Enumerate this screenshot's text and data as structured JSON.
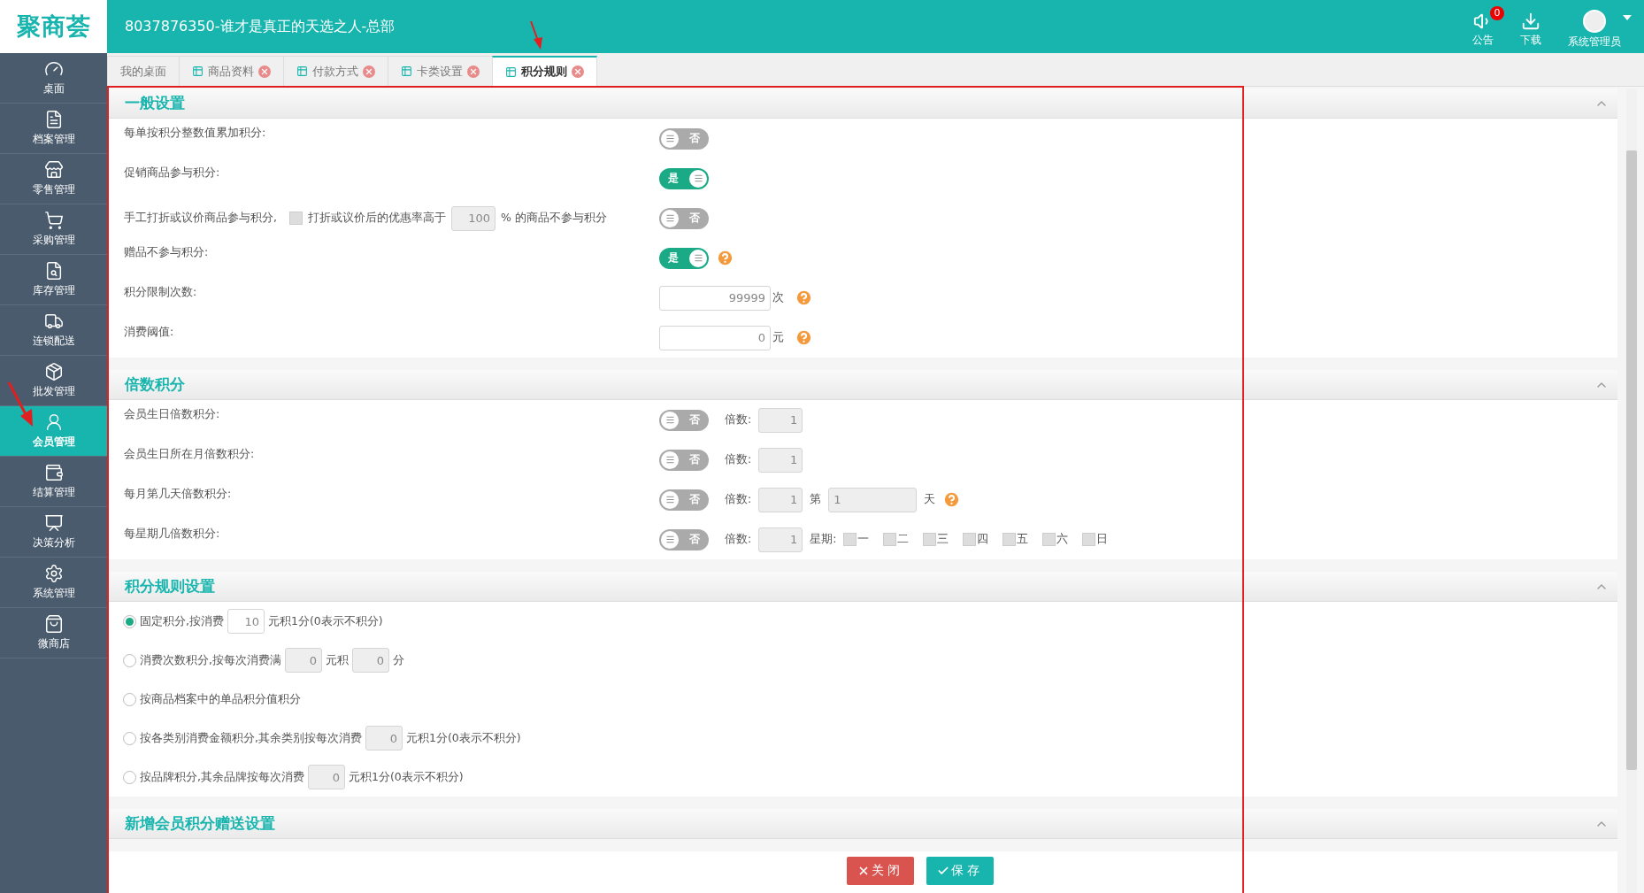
{
  "header": {
    "logo": "聚商荟",
    "title": "8037876350-谁才是真正的天选之人-总部",
    "actions": [
      {
        "kind": "notice",
        "label": "公告",
        "badge": "0"
      },
      {
        "kind": "download",
        "label": "下载"
      },
      {
        "kind": "user",
        "label": "系统管理员"
      }
    ]
  },
  "sidebar": {
    "items": [
      {
        "label": "桌面",
        "selected": false
      },
      {
        "label": "档案管理",
        "selected": false
      },
      {
        "label": "零售管理",
        "selected": false
      },
      {
        "label": "采购管理",
        "selected": false
      },
      {
        "label": "库存管理",
        "selected": false
      },
      {
        "label": "连锁配送",
        "selected": false
      },
      {
        "label": "批发管理",
        "selected": false
      },
      {
        "label": "会员管理",
        "selected": true
      },
      {
        "label": "结算管理",
        "selected": false
      },
      {
        "label": "决策分析",
        "selected": false
      },
      {
        "label": "系统管理",
        "selected": false
      },
      {
        "label": "微商店",
        "selected": false
      }
    ]
  },
  "tabs": [
    {
      "label": "我的桌面",
      "closable": false,
      "selected": false
    },
    {
      "label": "商品资料",
      "closable": true,
      "selected": false
    },
    {
      "label": "付款方式",
      "closable": true,
      "selected": false
    },
    {
      "label": "卡类设置",
      "closable": true,
      "selected": false
    },
    {
      "label": "积分规则",
      "closable": true,
      "selected": true
    }
  ],
  "sections": [
    {
      "title": "一般设置",
      "expanded": true,
      "rows": [
        {
          "kind": "toggle",
          "label": "每单按积分整数值累加积分:",
          "on": false,
          "toggle_text": "否"
        },
        {
          "kind": "toggle",
          "label": "促销商品参与积分:",
          "on": true,
          "toggle_text": "是"
        },
        {
          "kind": "discount",
          "label": "手工打折或议价商品参与积分,",
          "checked": false,
          "text": "打折或议价后的优惠率高于",
          "value": "100",
          "suffix": "% 的商品不参与积分",
          "on": false,
          "toggle_text": "否"
        },
        {
          "kind": "toggle",
          "label": "赠品不参与积分:",
          "on": true,
          "toggle_text": "是",
          "help": true
        },
        {
          "kind": "number",
          "label": "积分限制次数:",
          "value": "99999",
          "unit": "次",
          "help": true
        },
        {
          "kind": "number",
          "label": "消费阈值:",
          "value": "0",
          "unit": "元",
          "help": true
        }
      ]
    },
    {
      "title": "倍数积分",
      "expanded": true,
      "rows": [
        {
          "kind": "multiplier",
          "label": "会员生日倍数积分:",
          "on": false,
          "toggle_text": "否",
          "multiplier_label": "倍数:",
          "multiplier": "1"
        },
        {
          "kind": "multiplier",
          "label": "会员生日所在月倍数积分:",
          "on": false,
          "toggle_text": "否",
          "multiplier_label": "倍数:",
          "multiplier": "1"
        },
        {
          "kind": "multiplier",
          "label": "每月第几天倍数积分:",
          "on": false,
          "toggle_text": "否",
          "multiplier_label": "倍数:",
          "multiplier": "1",
          "day_prefix": "第",
          "day_value": "1",
          "day_suffix": "天",
          "help": true
        },
        {
          "kind": "multiplier",
          "label": "每星期几倍数积分:",
          "on": false,
          "toggle_text": "否",
          "multiplier_label": "倍数:",
          "multiplier": "1",
          "weekday_label": "星期:",
          "weekdays": [
            {
              "label": "一",
              "checked": false
            },
            {
              "label": "二",
              "checked": false
            },
            {
              "label": "三",
              "checked": false
            },
            {
              "label": "四",
              "checked": false
            },
            {
              "label": "五",
              "checked": false
            },
            {
              "label": "六",
              "checked": false
            },
            {
              "label": "日",
              "checked": false
            }
          ]
        }
      ]
    },
    {
      "title": "积分规则设置",
      "expanded": true,
      "rows": [
        {
          "kind": "radio",
          "selected": true,
          "parts": [
            {
              "kind": "text",
              "text": "固定积分,按消费"
            },
            {
              "kind": "input",
              "value": "10"
            },
            {
              "kind": "text",
              "text": "元积1分(0表示不积分)"
            }
          ]
        },
        {
          "kind": "radio",
          "selected": false,
          "parts": [
            {
              "kind": "text",
              "text": "消费次数积分,按每次消费满"
            },
            {
              "kind": "input",
              "value": "0"
            },
            {
              "kind": "text",
              "text": "元积"
            },
            {
              "kind": "input",
              "value": "0"
            },
            {
              "kind": "text",
              "text": "分"
            }
          ]
        },
        {
          "kind": "radio",
          "selected": false,
          "parts": [
            {
              "kind": "text",
              "text": "按商品档案中的单品积分值积分"
            }
          ]
        },
        {
          "kind": "radio",
          "selected": false,
          "parts": [
            {
              "kind": "text",
              "text": "按各类别消费金额积分,其余类别按每次消费"
            },
            {
              "kind": "input",
              "value": "0"
            },
            {
              "kind": "text",
              "text": "元积1分(0表示不积分)"
            }
          ]
        },
        {
          "kind": "radio",
          "selected": false,
          "parts": [
            {
              "kind": "text",
              "text": "按品牌积分,其余品牌按每次消费"
            },
            {
              "kind": "input",
              "value": "0"
            },
            {
              "kind": "text",
              "text": "元积1分(0表示不积分)"
            }
          ]
        }
      ]
    },
    {
      "title": "新增会员积分赠送设置",
      "expanded": true
    }
  ],
  "buttons": [
    {
      "kind": "close",
      "label": "关闭"
    },
    {
      "kind": "save",
      "label": "保存"
    }
  ]
}
